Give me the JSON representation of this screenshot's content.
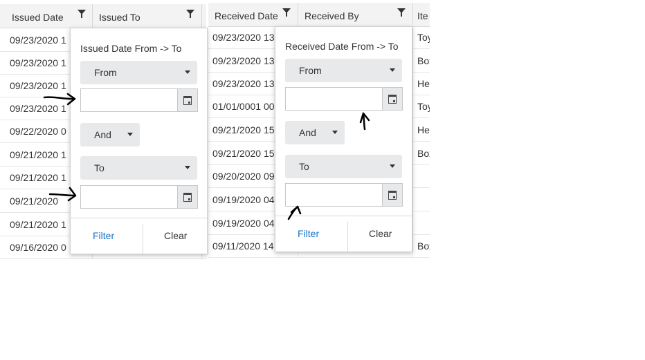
{
  "left_grid": {
    "headers": [
      "Issued Date",
      "Issued To"
    ],
    "issued_dates": [
      "09/23/2020 1",
      "09/23/2020 1",
      "09/23/2020 1",
      "09/23/2020 1",
      "09/22/2020 0",
      "09/21/2020 1",
      "09/21/2020 1",
      "09/21/2020",
      "09/21/2020 1",
      "09/16/2020 0"
    ]
  },
  "right_grid": {
    "headers": [
      "Received Date",
      "Received By",
      "Ite"
    ],
    "received_dates": [
      "09/23/2020 13",
      "09/23/2020 13",
      "09/23/2020 13",
      "01/01/0001 00",
      "09/21/2020 15",
      "09/21/2020 15",
      "09/20/2020 09",
      "09/19/2020 04",
      "09/19/2020 04",
      "09/11/2020 14"
    ],
    "items": [
      "Toy",
      "Box",
      "He",
      "Toy",
      "He",
      "Box",
      "",
      "",
      "",
      "Box"
    ]
  },
  "issued_filter": {
    "title": "Issued Date From -> To",
    "from_select": "From",
    "logic_select": "And",
    "to_select": "To",
    "from_value": "",
    "to_value": "",
    "filter_label": "Filter",
    "clear_label": "Clear"
  },
  "received_filter": {
    "title": "Received Date From -> To",
    "from_select": "From",
    "logic_select": "And",
    "to_select": "To",
    "from_value": "",
    "to_value": "",
    "filter_label": "Filter",
    "clear_label": "Clear"
  },
  "colors": {
    "accent": "#1a73c7",
    "header_bg": "#f3f3f3",
    "select_bg": "#e8e9ea",
    "annotation": "#000000"
  },
  "icons": [
    "filter-icon",
    "calendar-icon",
    "dropdown-caret-icon"
  ]
}
